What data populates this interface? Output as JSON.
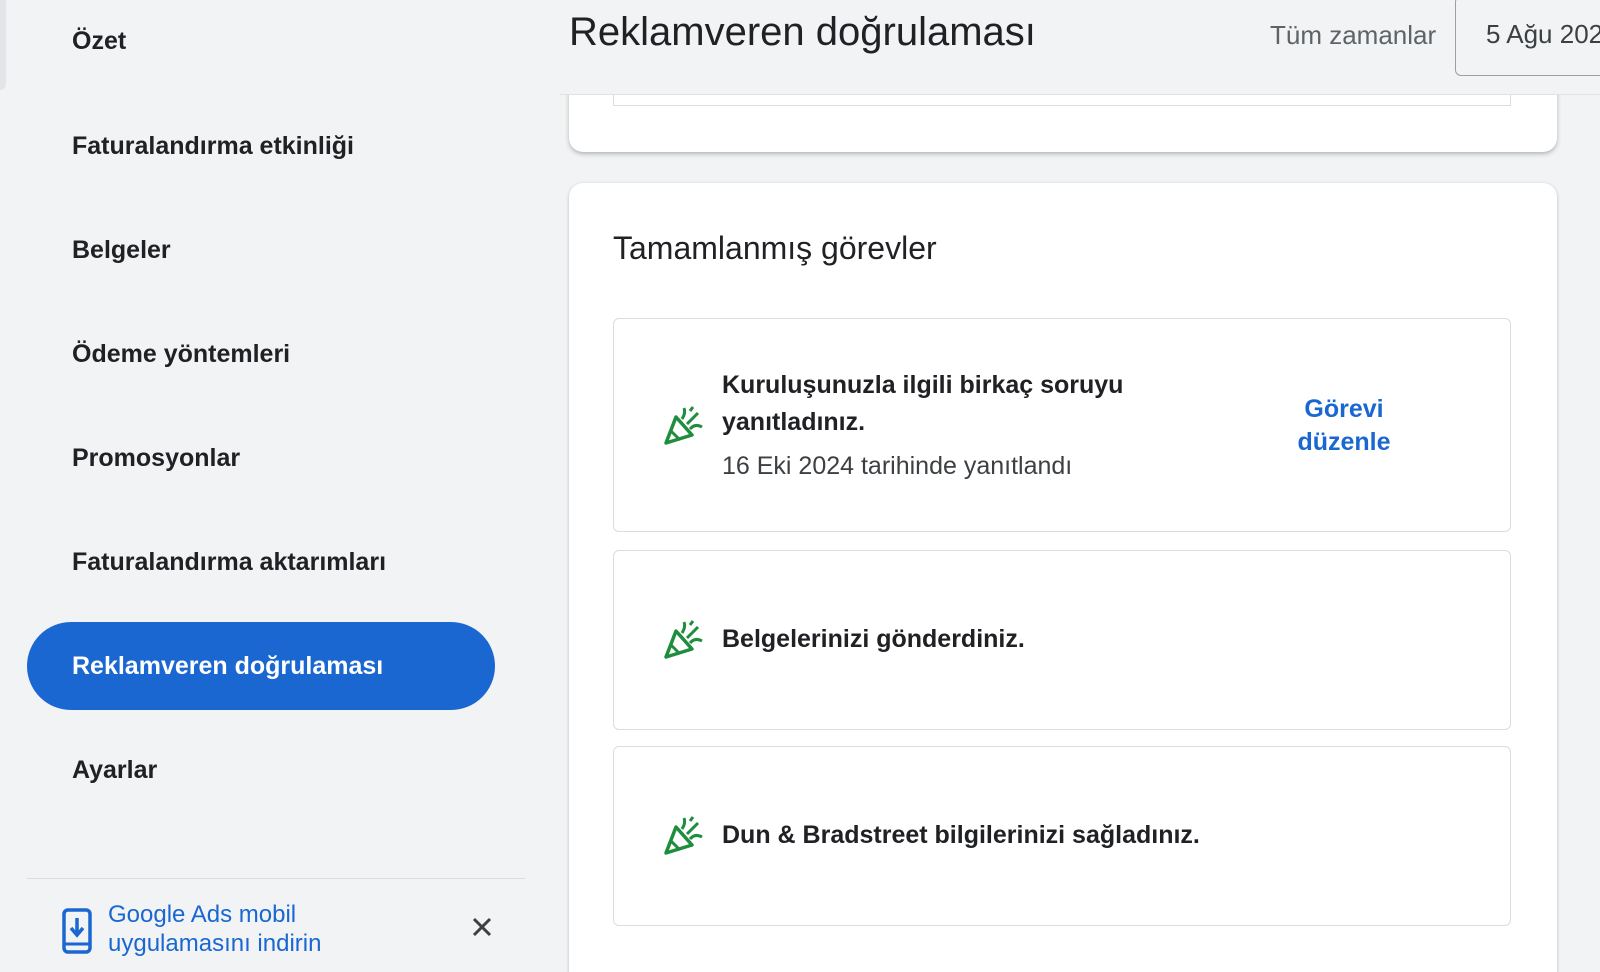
{
  "sidebar": {
    "items": [
      {
        "label": "Özet",
        "active": false
      },
      {
        "label": "Faturalandırma etkinliği",
        "active": false
      },
      {
        "label": "Belgeler",
        "active": false
      },
      {
        "label": "Ödeme yöntemleri",
        "active": false
      },
      {
        "label": "Promosyonlar",
        "active": false
      },
      {
        "label": "Faturalandırma aktarımları",
        "active": false
      },
      {
        "label": "Reklamveren doğrulaması",
        "active": true
      },
      {
        "label": "Ayarlar",
        "active": false
      }
    ],
    "promo": {
      "icon": "phone-download-icon",
      "text": "Google Ads mobil uygulamasını indirin",
      "close_icon": "close-icon"
    }
  },
  "header": {
    "title": "Reklamveren doğrulaması",
    "range_label": "Tüm zamanlar",
    "date_value": "5 Ağu 202"
  },
  "completed_tasks": {
    "title": "Tamamlanmış görevler",
    "tasks": [
      {
        "icon": "celebration-icon",
        "title": "Kuruluşunuzla ilgili birkaç soruyu yanıtladınız.",
        "subtitle": "16 Eki 2024 tarihinde yanıtlandı",
        "action": "Görevi düzenle"
      },
      {
        "icon": "celebration-icon",
        "title": "Belgelerinizi gönderdiniz."
      },
      {
        "icon": "celebration-icon",
        "title": "Dun & Bradstreet bilgilerinizi sağladınız."
      }
    ]
  },
  "colors": {
    "accent": "#1a67d2",
    "background": "#f1f3f4",
    "icon_green": "#1e8e3e"
  }
}
